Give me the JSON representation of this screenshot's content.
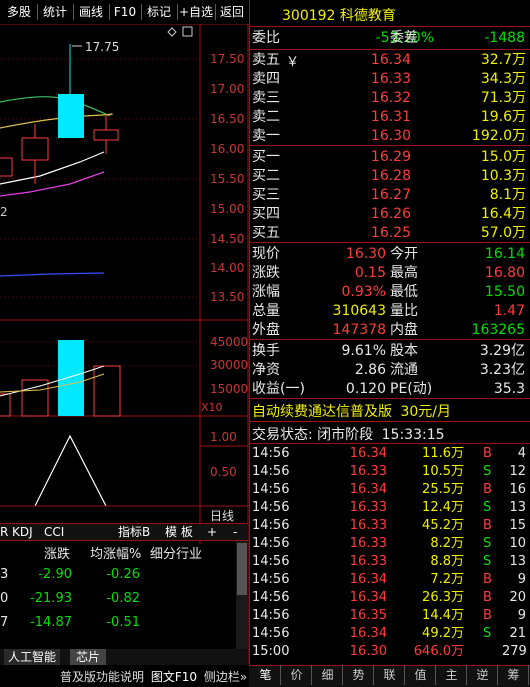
{
  "toolbar": {
    "buttons": [
      "多股",
      "统计",
      "画线",
      "F10",
      "标记",
      "+自选",
      "返回"
    ]
  },
  "stock": {
    "code": "300192",
    "name": "科德教育"
  },
  "chart": {
    "price_axis": [
      "17.50",
      "17.00",
      "16.50",
      "16.00",
      "15.50",
      "15.00",
      "14.50",
      "14.00",
      "13.50"
    ],
    "high_marker": "17.75",
    "left_stub": "2",
    "volume_axis": [
      "45000",
      "30000",
      "15000"
    ],
    "volume_unit": "X10",
    "indicator_axis": [
      "1.00",
      "0.50"
    ],
    "period_label": "日线",
    "indicator_tabs": [
      "R",
      "KDJ",
      "CCI"
    ],
    "indicator_menu": "指标B",
    "template_menu": "模 板",
    "plus": "+",
    "minus": "-"
  },
  "sector_table": {
    "headers": [
      "涨跌",
      "均涨幅%",
      "细分行业"
    ],
    "rows": [
      {
        "code": "3",
        "change": "-2.90",
        "avg": "-0.26"
      },
      {
        "code": "0",
        "change": "-21.93",
        "avg": "-0.82"
      },
      {
        "code": "7",
        "change": "-14.87",
        "avg": "-0.51"
      }
    ],
    "tabs": [
      "人工智能",
      "芯片"
    ]
  },
  "quote": {
    "weibi_label": "委比",
    "weibi": "-53.10%",
    "weicha_label": "委差",
    "weicha": "-1488",
    "sell": [
      {
        "label": "卖五",
        "price": "16.34",
        "vol": "32.7万"
      },
      {
        "label": "卖四",
        "price": "16.33",
        "vol": "34.3万"
      },
      {
        "label": "卖三",
        "price": "16.32",
        "vol": "71.3万"
      },
      {
        "label": "卖二",
        "price": "16.31",
        "vol": "19.6万"
      },
      {
        "label": "卖一",
        "price": "16.30",
        "vol": "192.0万"
      }
    ],
    "sell5_mark": "￥",
    "buy": [
      {
        "label": "买一",
        "price": "16.29",
        "vol": "15.0万"
      },
      {
        "label": "买二",
        "price": "16.28",
        "vol": "10.3万"
      },
      {
        "label": "买三",
        "price": "16.27",
        "vol": "8.1万"
      },
      {
        "label": "买四",
        "price": "16.26",
        "vol": "16.4万"
      },
      {
        "label": "买五",
        "price": "16.25",
        "vol": "57.0万"
      }
    ],
    "stats": [
      {
        "l1": "现价",
        "v1": "16.30",
        "c1": "red",
        "l2": "今开",
        "v2": "16.14",
        "c2": "green"
      },
      {
        "l1": "涨跌",
        "v1": "0.15",
        "c1": "red",
        "l2": "最高",
        "v2": "16.80",
        "c2": "red"
      },
      {
        "l1": "涨幅",
        "v1": "0.93%",
        "c1": "red",
        "l2": "最低",
        "v2": "15.50",
        "c2": "green"
      },
      {
        "l1": "总量",
        "v1": "310643",
        "c1": "yellow",
        "l2": "量比",
        "v2": "1.47",
        "c2": "red"
      },
      {
        "l1": "外盘",
        "v1": "147378",
        "c1": "red",
        "l2": "内盘",
        "v2": "163265",
        "c2": "green"
      }
    ],
    "stats2": [
      {
        "l1": "换手",
        "v1": "9.61%",
        "l2": "股本",
        "v2": "3.29亿"
      },
      {
        "l1": "净资",
        "v1": "2.86",
        "l2": "流通",
        "v2": "3.23亿"
      },
      {
        "l1": "收益(一)",
        "v1": "0.120",
        "l2": "PE(动)",
        "v2": "35.3"
      }
    ]
  },
  "promo": {
    "text": "自动续费通达信普及版",
    "price": "30元/月"
  },
  "trade_status": {
    "label": "交易状态: 闭市阶段",
    "time": "15:33:15"
  },
  "ticks": [
    {
      "t": "14:56",
      "p": "16.34",
      "v": "11.6万",
      "bs": "B",
      "n": "4"
    },
    {
      "t": "14:56",
      "p": "16.33",
      "v": "10.5万",
      "bs": "S",
      "n": "12"
    },
    {
      "t": "14:56",
      "p": "16.34",
      "v": "25.5万",
      "bs": "B",
      "n": "16"
    },
    {
      "t": "14:56",
      "p": "16.33",
      "v": "12.4万",
      "bs": "S",
      "n": "13"
    },
    {
      "t": "14:56",
      "p": "16.33",
      "v": "45.2万",
      "bs": "B",
      "n": "15"
    },
    {
      "t": "14:56",
      "p": "16.33",
      "v": "8.2万",
      "bs": "S",
      "n": "10"
    },
    {
      "t": "14:56",
      "p": "16.33",
      "v": "8.8万",
      "bs": "S",
      "n": "13"
    },
    {
      "t": "14:56",
      "p": "16.34",
      "v": "7.2万",
      "bs": "B",
      "n": "9"
    },
    {
      "t": "14:56",
      "p": "16.34",
      "v": "26.3万",
      "bs": "B",
      "n": "20"
    },
    {
      "t": "14:56",
      "p": "16.35",
      "v": "14.4万",
      "bs": "B",
      "n": "9"
    },
    {
      "t": "14:56",
      "p": "16.34",
      "v": "49.2万",
      "bs": "S",
      "n": "21"
    },
    {
      "t": "15:00",
      "p": "16.30",
      "v": "646.0万",
      "bs": "",
      "n": "279"
    }
  ],
  "bottom_tabs": [
    "笔",
    "价",
    "细",
    "势",
    "联",
    "值",
    "主",
    "逆",
    "筹"
  ],
  "status_bar": {
    "text": "普及版功能说明",
    "f10": "图文F10",
    "sidebar": "侧边栏»"
  }
}
